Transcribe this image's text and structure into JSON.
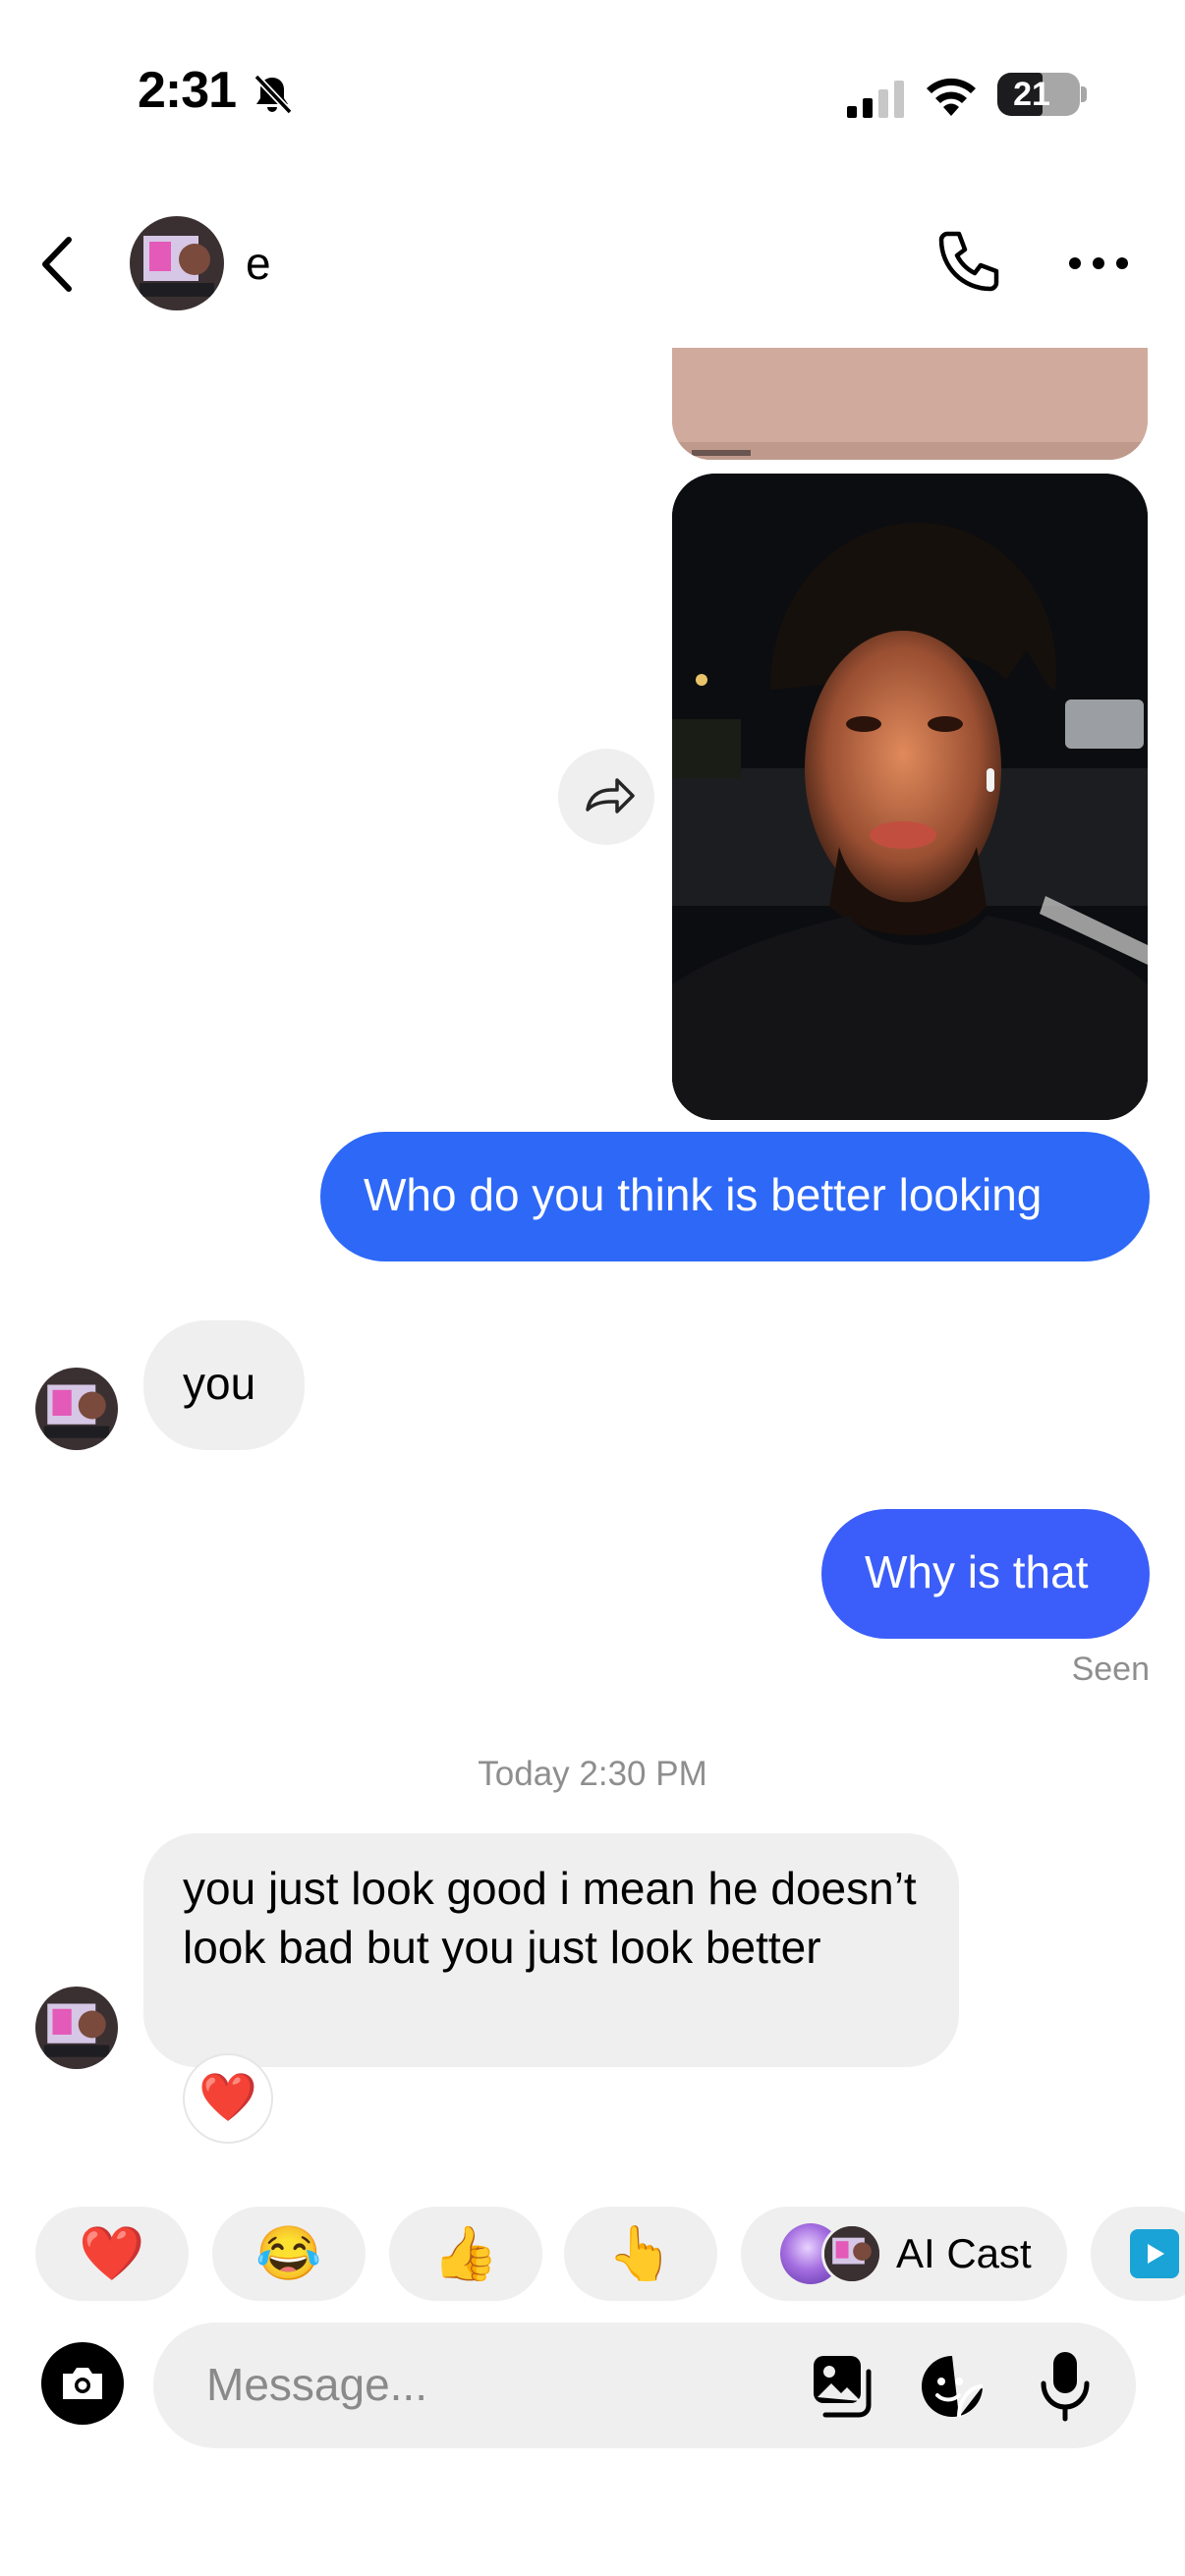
{
  "status_bar": {
    "time": "2:31",
    "battery": "21"
  },
  "header": {
    "contact_name": "e",
    "icons": [
      "back-icon",
      "phone-icon",
      "more-icon"
    ]
  },
  "messages": [
    {
      "type": "image",
      "direction": "outgoing",
      "description_icon": "photo"
    },
    {
      "type": "image",
      "direction": "outgoing",
      "description_icon": "photo"
    },
    {
      "type": "text",
      "direction": "outgoing",
      "text": "Who do you think is better looking"
    },
    {
      "type": "text",
      "direction": "incoming",
      "text": "you"
    },
    {
      "type": "text",
      "direction": "outgoing",
      "text": "Why is that"
    },
    {
      "type": "text",
      "direction": "incoming",
      "text": "you just look good i mean he doesn’t look bad but you just look better",
      "reaction": "❤️"
    }
  ],
  "seen_label": "Seen",
  "timestamp": "Today 2:30 PM",
  "quick_reactions": {
    "emojis": [
      "❤️",
      "😂",
      "👍",
      "👆"
    ],
    "ai_cast_label": "AI Cast"
  },
  "composer": {
    "placeholder": "Message..."
  },
  "colors": {
    "outgoing_bubble": "#3f5efb",
    "incoming_bubble": "#efefef",
    "meta_text": "#8e8e8e"
  }
}
